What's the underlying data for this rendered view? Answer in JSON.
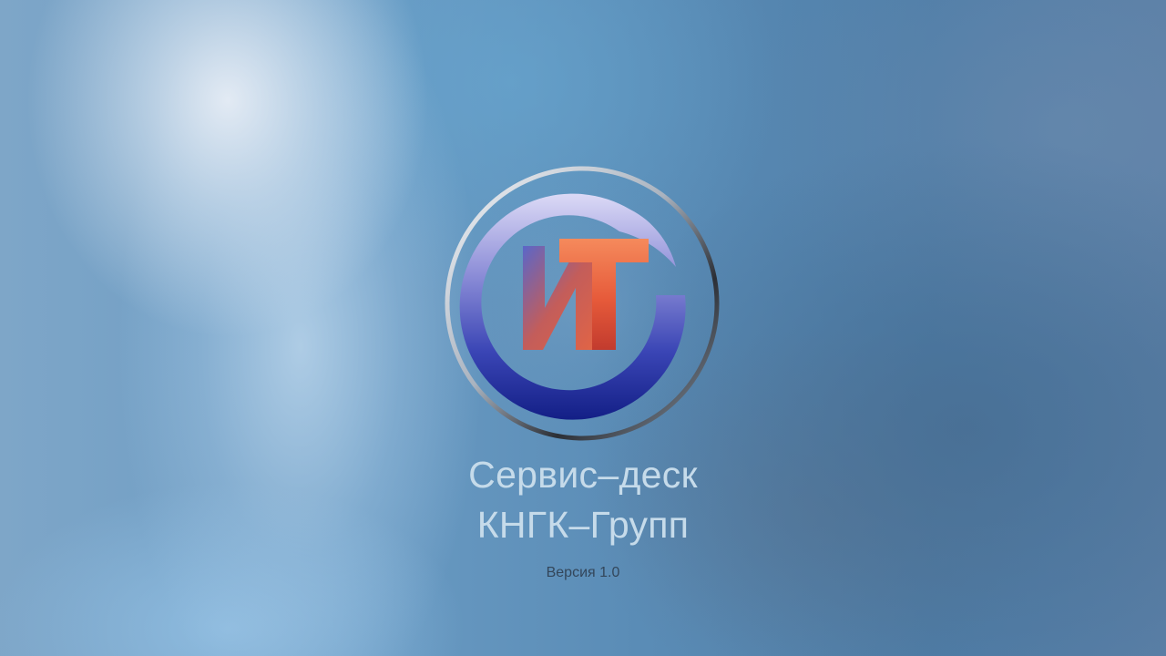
{
  "splash": {
    "title_line_1": "Сервис–деск",
    "title_line_2": "КНГК–Групп",
    "version": "Версия 1.0"
  },
  "logo": {
    "icon": "it-logo-icon",
    "lettering": "ИТ",
    "colors": {
      "ring": "#d8dee6",
      "swoosh_dark": "#1a2a8a",
      "swoosh_light": "#c9c9ef",
      "letters": "#ef6a45"
    }
  }
}
